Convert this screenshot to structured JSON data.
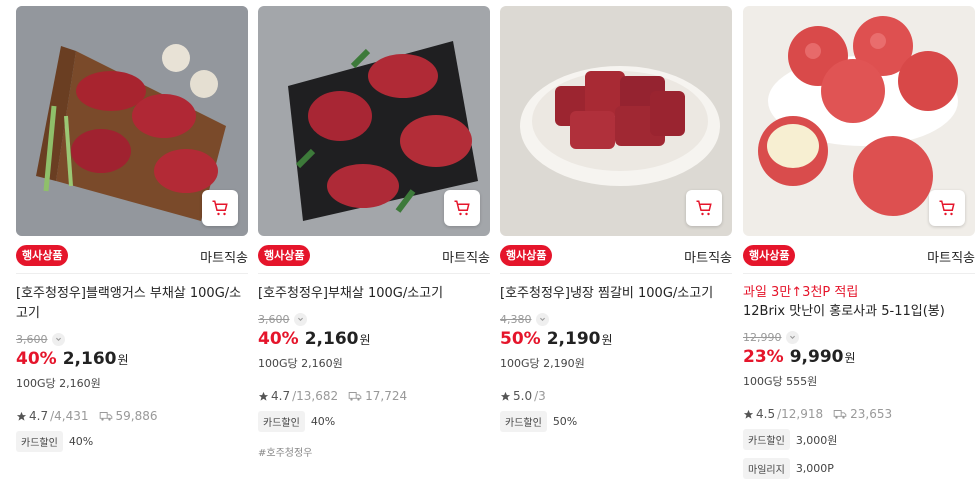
{
  "products": [
    {
      "badge": "행사상품",
      "delivery": "마트직송",
      "title": "[호주청정우]블랙앵거스 부채살 100G/소고기",
      "original_price": "3,600",
      "discount": "40%",
      "price": "2,160",
      "won": "원",
      "unit_price": "100G당 2,160원",
      "rating": "4.7",
      "review_count": "/4,431",
      "delivery_count": "59,886",
      "benefits": [
        {
          "chip": "카드할인",
          "value": "40%"
        }
      ]
    },
    {
      "badge": "행사상품",
      "delivery": "마트직송",
      "title": "[호주청정우]부채살 100G/소고기",
      "original_price": "3,600",
      "discount": "40%",
      "price": "2,160",
      "won": "원",
      "unit_price": "100G당 2,160원",
      "rating": "4.7",
      "review_count": "/13,682",
      "delivery_count": "17,724",
      "benefits": [
        {
          "chip": "카드할인",
          "value": "40%"
        }
      ],
      "tag": "#호주청정우"
    },
    {
      "badge": "행사상품",
      "delivery": "마트직송",
      "title": "[호주청정우]냉장 찜갈비 100G/소고기",
      "original_price": "4,380",
      "discount": "50%",
      "price": "2,190",
      "won": "원",
      "unit_price": "100G당 2,190원",
      "rating": "5.0",
      "review_count": "/3",
      "benefits": [
        {
          "chip": "카드할인",
          "value": "50%"
        }
      ]
    },
    {
      "badge": "행사상품",
      "delivery": "마트직송",
      "promo": "과일 3만↑3천P 적립",
      "title": "12Brix 맛난이 홍로사과 5-11입(봉)",
      "original_price": "12,990",
      "discount": "23%",
      "price": "9,990",
      "won": "원",
      "unit_price": "100G당 555원",
      "rating": "4.5",
      "review_count": "/12,918",
      "delivery_count": "23,653",
      "benefits": [
        {
          "chip": "카드할인",
          "value": "3,000원"
        },
        {
          "chip": "마일리지",
          "value": "3,000P"
        }
      ]
    }
  ],
  "icons": {
    "cart": "cart-icon",
    "star": "star-icon",
    "delivery": "truck-icon",
    "chevron": "chevron-down-icon"
  },
  "colors": {
    "accent": "#e5152b",
    "badge_text": "#ffffff",
    "muted": "#999999"
  }
}
